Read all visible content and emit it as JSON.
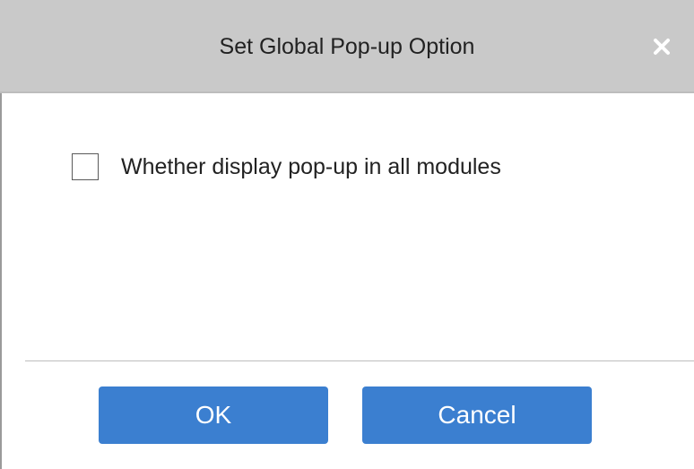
{
  "dialog": {
    "title": "Set Global Pop-up Option",
    "close_icon": "close-icon"
  },
  "option": {
    "label": "Whether display pop-up in all modules",
    "checked": false
  },
  "buttons": {
    "ok_label": "OK",
    "cancel_label": "Cancel"
  },
  "colors": {
    "titlebar": "#c9c9c9",
    "primary_button": "#3b7fd0"
  }
}
